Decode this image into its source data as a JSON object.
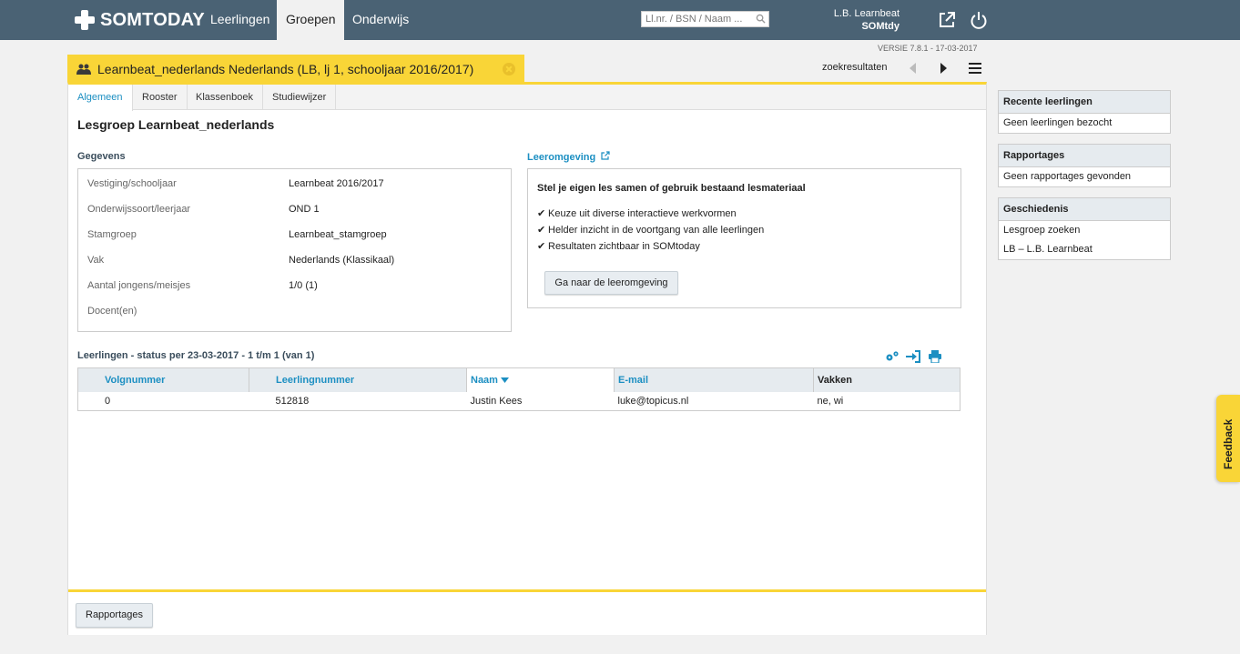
{
  "topbar": {
    "brand": "SOMTODAY",
    "nav": [
      {
        "label": "Leerlingen",
        "active": false
      },
      {
        "label": "Groepen",
        "active": true
      },
      {
        "label": "Onderwijs",
        "active": false
      }
    ],
    "search_placeholder": "Ll.nr. / BSN / Naam ...",
    "user_name": "L.B. Learnbeat",
    "user_org": "SOMtdy",
    "icons": [
      "external-link-icon",
      "power-icon"
    ]
  },
  "version": "VERSIE 7.8.1 - 17-03-2017",
  "group_tab": {
    "title": "Learnbeat_nederlands Nederlands (LB, lj 1, schooljaar 2016/2017)",
    "icon": "users-icon"
  },
  "results_nav": {
    "label": "zoekresultaten"
  },
  "subtabs": [
    "Algemeen",
    "Rooster",
    "Klassenboek",
    "Studiewijzer"
  ],
  "page_title": "Lesgroep Learnbeat_nederlands",
  "gegevens": {
    "title": "Gegevens",
    "rows": [
      {
        "label": "Vestiging/schooljaar",
        "value": "Learnbeat 2016/2017"
      },
      {
        "label": "Onderwijssoort/leerjaar",
        "value": "OND 1"
      },
      {
        "label": "Stamgroep",
        "value": "Learnbeat_stamgroep"
      },
      {
        "label": "Vak",
        "value": "Nederlands (Klassikaal)"
      },
      {
        "label": "Aantal jongens/meisjes",
        "value": "1/0 (1)"
      },
      {
        "label": "Docent(en)",
        "value": ""
      }
    ]
  },
  "leeromgeving": {
    "title": "Leeromgeving",
    "heading": "Stel je eigen les samen of gebruik bestaand lesmateriaal",
    "items": [
      "Keuze uit diverse interactieve werkvormen",
      "Helder inzicht in de voortgang van alle leerlingen",
      "Resultaten zichtbaar in SOMtoday"
    ],
    "button": "Ga naar de leeromgeving"
  },
  "leerlingen": {
    "title": "Leerlingen - status per 23-03-2017 - 1 t/m 1 (van 1)",
    "columns": [
      "Volgnummer",
      "Leerlingnummer",
      "Naam",
      "E-mail",
      "Vakken"
    ],
    "rows": [
      [
        "0",
        "512818",
        "Justin Kees",
        "luke@topicus.nl",
        "ne, wi"
      ]
    ]
  },
  "bottom_button": "Rapportages",
  "sidebar": {
    "boxes": [
      {
        "title": "Recente leerlingen",
        "items": [
          "Geen leerlingen bezocht"
        ]
      },
      {
        "title": "Rapportages",
        "items": [
          "Geen rapportages gevonden"
        ]
      },
      {
        "title": "Geschiedenis",
        "items": [
          "Lesgroep zoeken",
          "LB – L.B. Learnbeat"
        ]
      }
    ]
  },
  "feedback": "Feedback",
  "colors": {
    "topbar": "#4a6274",
    "accent_yellow": "#f9d537",
    "link_blue": "#1c8fc2"
  }
}
